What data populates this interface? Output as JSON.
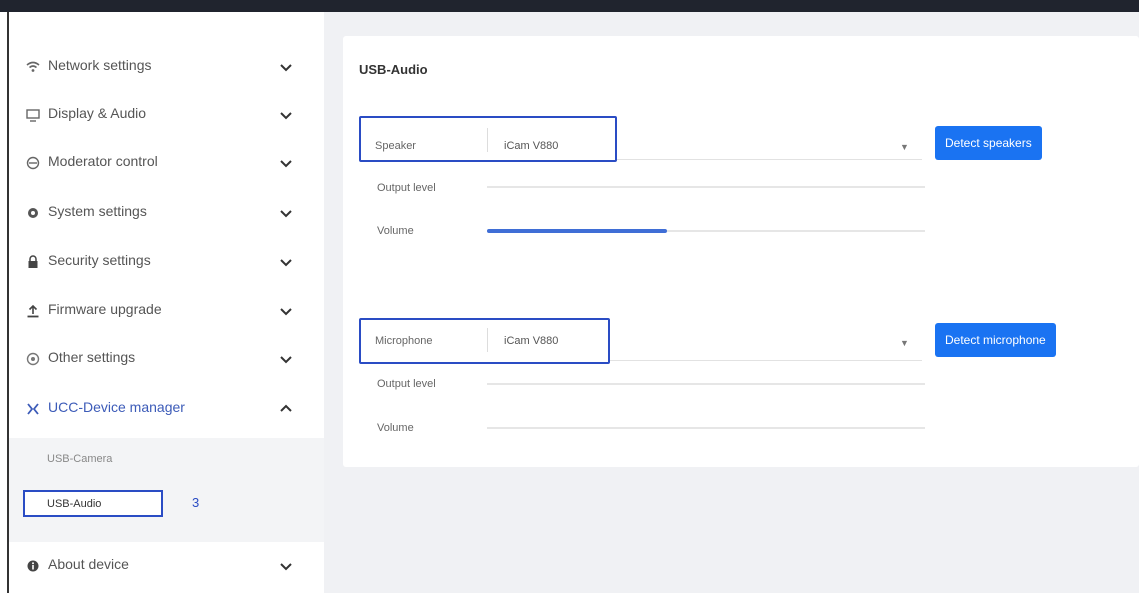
{
  "sidebar": {
    "items": [
      {
        "label": "Network settings",
        "icon": "wifi-icon"
      },
      {
        "label": "Display & Audio",
        "icon": "monitor-icon"
      },
      {
        "label": "Moderator control",
        "icon": "moderator-icon"
      },
      {
        "label": "System settings",
        "icon": "gear-icon"
      },
      {
        "label": "Security settings",
        "icon": "lock-icon"
      },
      {
        "label": "Firmware upgrade",
        "icon": "upload-icon"
      },
      {
        "label": "Other settings",
        "icon": "settings-icon"
      },
      {
        "label": "UCC-Device manager",
        "icon": "device-manager-icon"
      },
      {
        "label": "About device",
        "icon": "info-icon"
      }
    ],
    "sub_items": {
      "usb_camera": "USB-Camera",
      "usb_audio": "USB-Audio"
    },
    "step_annotation": "3"
  },
  "main": {
    "title": "USB-Audio",
    "speaker": {
      "label": "Speaker",
      "value": "iCam V880",
      "button": "Detect speakers",
      "output_label": "Output level",
      "volume_label": "Volume",
      "volume_fraction": 0.41
    },
    "microphone": {
      "label": "Microphone",
      "value": "iCam V880",
      "button": "Detect microphone",
      "output_label": "Output level",
      "volume_label": "Volume",
      "volume_fraction": 0
    }
  },
  "colors": {
    "accent": "#1a73f2",
    "highlight_border": "#2a4cc4",
    "active_nav": "#3c5bb8",
    "content_bg": "#f0f1f4"
  }
}
